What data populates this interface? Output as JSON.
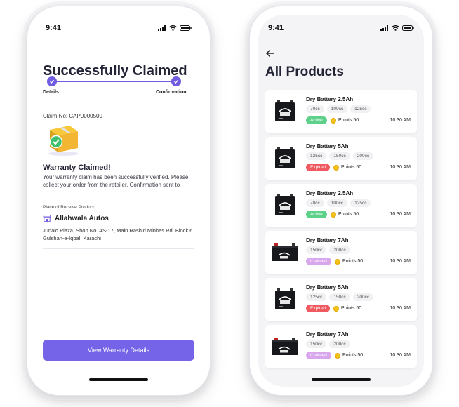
{
  "colors": {
    "accent": "#7664e8",
    "active": "#5dd18a",
    "expired": "#ee5a5f",
    "claimed": "#d8a6ec",
    "coin": "#f4c21b"
  },
  "left_screen": {
    "status_time": "9:41",
    "title": "Successfully Claimed",
    "steps": [
      "Details",
      "Confirmation"
    ],
    "claim_number": "Claim No: CAP0000500",
    "heading": "Warranty Claimed!",
    "message": "Your warranty claim has been successfully verified. Please collect your order from the retailer. Confirmation sent to",
    "receive_label": "Place of Receive Product:",
    "retailer_name": "Allahwala Autos",
    "retailer_address": "Junaid Plaza, Shop No. AS-17, Main Rashid Minhas Rd, Block 6 Gulshan-e-Iqbal, Karachi",
    "button_label": "View Warranty Details"
  },
  "right_screen": {
    "status_time": "9:41",
    "title": "All Products",
    "products": [
      {
        "name": "Dry Battery 2.5Ah",
        "cc": [
          "70cc",
          "100cc",
          "125cc"
        ],
        "status": "Active",
        "points": "Points 50",
        "time": "10:30 AM",
        "image": "battery-small-icon"
      },
      {
        "name": "Dry Battery 5Ah",
        "cc": [
          "125cc",
          "150cc",
          "200cc"
        ],
        "status": "Expired",
        "points": "Points 50",
        "time": "10:30 AM",
        "image": "battery-small-icon"
      },
      {
        "name": "Dry Battery 2.5Ah",
        "cc": [
          "70cc",
          "100cc",
          "125cc"
        ],
        "status": "Active",
        "points": "Points 50",
        "time": "10:30 AM",
        "image": "battery-small-icon"
      },
      {
        "name": "Dry Battery 7Ah",
        "cc": [
          "150cc",
          "200cc"
        ],
        "status": "Claimed",
        "points": "Points 50",
        "time": "10:30 AM",
        "image": "battery-wide-icon"
      },
      {
        "name": "Dry Battery 5Ah",
        "cc": [
          "125cc",
          "150cc",
          "200cc"
        ],
        "status": "Expired",
        "points": "Points 50",
        "time": "10:30 AM",
        "image": "battery-small-icon"
      },
      {
        "name": "Dry Battery 7Ah",
        "cc": [
          "150cc",
          "200cc"
        ],
        "status": "Claimed",
        "points": "Points 50",
        "time": "10:30 AM",
        "image": "battery-wide-icon"
      }
    ]
  }
}
